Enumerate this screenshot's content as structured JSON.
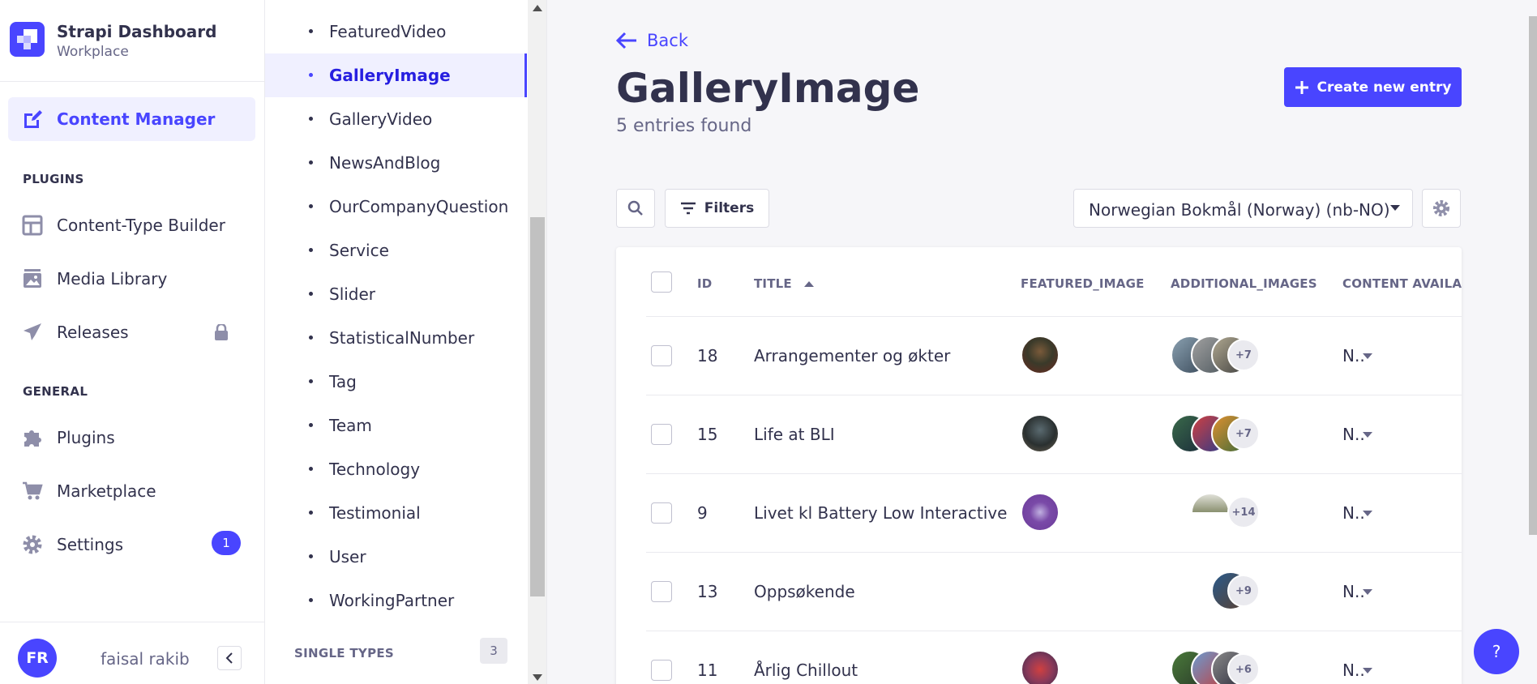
{
  "brand": {
    "title": "Strapi Dashboard",
    "subtitle": "Workplace"
  },
  "mainnav": {
    "active_item": "Content Manager",
    "plugins_section": "PLUGINS",
    "plugins": [
      "Content-Type Builder",
      "Media Library",
      "Releases"
    ],
    "general_section": "GENERAL",
    "general": [
      "Plugins",
      "Marketplace",
      "Settings"
    ],
    "settings_badge": "1"
  },
  "user": {
    "initials": "FR",
    "name": "faisal rakib"
  },
  "subnav": {
    "items": [
      "FeaturedVideo",
      "GalleryImage",
      "GalleryVideo",
      "NewsAndBlog",
      "OurCompanyQuestion",
      "Service",
      "Slider",
      "StatisticalNumber",
      "Tag",
      "Team",
      "Technology",
      "Testimonial",
      "User",
      "WorkingPartner"
    ],
    "active": "GalleryImage",
    "single_types_label": "SINGLE TYPES",
    "single_types_count": "3"
  },
  "header": {
    "back_label": "Back",
    "title": "GalleryImage",
    "subtitle": "5 entries found",
    "create_label": "Create new entry"
  },
  "toolbar": {
    "filters_label": "Filters",
    "locale_value": "Norwegian Bokmål (Norway) (nb-NO)"
  },
  "table": {
    "columns": [
      "ID",
      "TITLE",
      "FEATURED_IMAGE",
      "ADDITIONAL_IMAGES",
      "CONTENT AVAILAB"
    ],
    "rows": [
      {
        "id": "18",
        "title": "Arrangementer og økter",
        "more": "+7",
        "status": "N.."
      },
      {
        "id": "15",
        "title": "Life at BLI",
        "more": "+7",
        "status": "N.."
      },
      {
        "id": "9",
        "title": "Livet kl Battery Low Interactive",
        "more": "+14",
        "status": "N.."
      },
      {
        "id": "13",
        "title": "Oppsøkende",
        "more": "+9",
        "status": "N.."
      },
      {
        "id": "11",
        "title": "Årlig Chillout",
        "more": "+6",
        "status": "N.."
      }
    ]
  },
  "help_label": "?",
  "colors": {
    "primary": "#4945ff",
    "text": "#32324d",
    "muted": "#666687",
    "background": "#f6f6f9"
  }
}
